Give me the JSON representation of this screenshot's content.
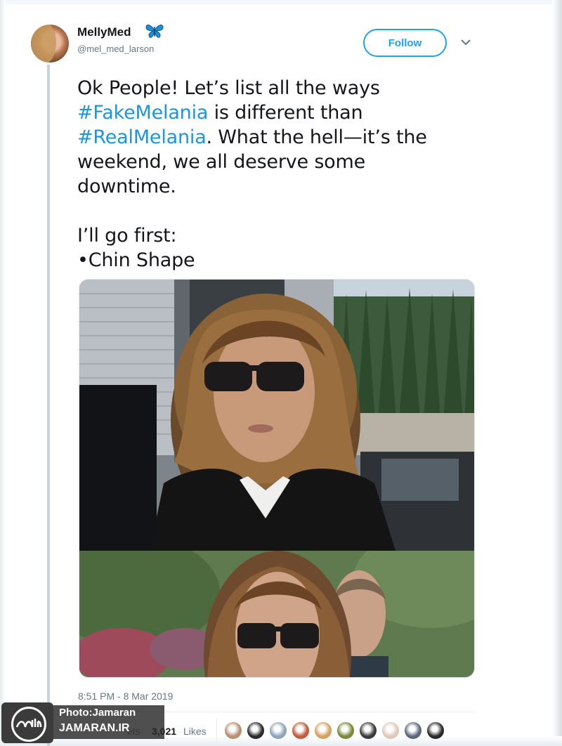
{
  "user": {
    "display_name": "MellyMed",
    "handle": "@mel_med_larson",
    "badge_icon": "butterfly-icon",
    "badge_color": "#1d8fd6"
  },
  "follow_label": "Follow",
  "tweet": {
    "line1": "Ok People! Let’s list all the ways",
    "hashtag1": "#FakeMelania",
    "line2_rest": " is different than",
    "hashtag2": "#RealMelania",
    "line3_rest": ". What the hell—it’s the",
    "line4": "weekend, we all deserve some",
    "line5": "downtime.",
    "line6": "I’ll go first:",
    "line7": "•Chin Shape"
  },
  "timestamp": "8:51 PM - 8 Mar 2019",
  "stats": {
    "retweets_fragment": "ets",
    "likes_count": "3,021",
    "likes_label": "Likes"
  },
  "liker_avatar_colors": [
    "#b89070",
    "#2b2b2b",
    "#8fa4b8",
    "#c35a3a",
    "#d6a060",
    "#7a8a3a",
    "#3a3a3a",
    "#e0c8b8",
    "#5a6a7a",
    "#2a2a2a"
  ],
  "watermark": {
    "line1": "Photo:Jamaran",
    "line2": "JAMARAN.IR"
  },
  "colors": {
    "link": "#1b95e0",
    "follow": "#1da1f2",
    "secondary_text": "#657786",
    "thread_line": "#c4d4e2"
  }
}
